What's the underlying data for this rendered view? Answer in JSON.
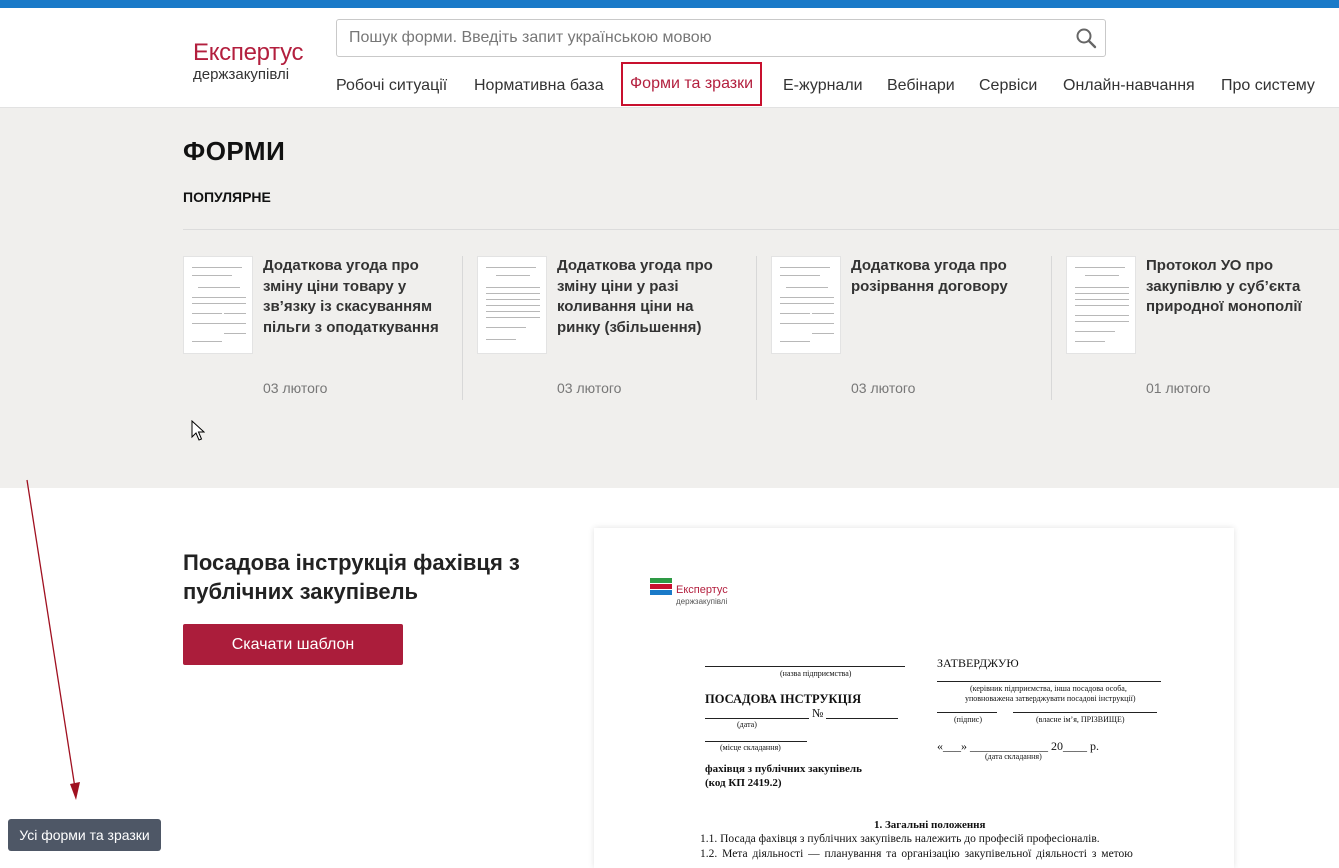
{
  "header": {
    "logo_main": "Експертус",
    "logo_sub": "держзакупівлі",
    "search_placeholder": "Пошук форми. Введіть запит українською мовою"
  },
  "nav": {
    "items": [
      {
        "label": "Робочі ситуації"
      },
      {
        "label": "Нормативна база"
      },
      {
        "label": "Форми та зразки",
        "active": true
      },
      {
        "label": "Е-журнали"
      },
      {
        "label": "Вебінари"
      },
      {
        "label": "Сервіси"
      },
      {
        "label": "Онлайн-навчання"
      },
      {
        "label": "Про систему"
      }
    ]
  },
  "forms": {
    "heading": "ФОРМИ",
    "popular_heading": "ПОПУЛЯРНЕ",
    "cards": [
      {
        "title": "Додаткова угода про зміну ціни товару у зв’язку із скасуванням пільги з оподаткування",
        "date": "03 лютого"
      },
      {
        "title": "Додаткова угода про зміну ціни у разі коливання ціни на ринку (збільшення)",
        "date": "03 лютого"
      },
      {
        "title": "Додаткова угода про розірвання договору",
        "date": "03 лютого"
      },
      {
        "title": "Протокол УО про закупівлю у суб’єкта природної монополії",
        "date": "01 лютого"
      }
    ]
  },
  "document": {
    "title": "Посадова інструкція фахівця з публічних закупівель",
    "download_label": "Скачати шаблон",
    "preview": {
      "logo_main": "Експертус",
      "logo_sub": "держзакупівлі",
      "company_caption": "(назва підприємства)",
      "approve": "ЗАТВЕРДЖУЮ",
      "head_caption_1": "(керівник підприємства, інша посадова особа,",
      "head_caption_2": "уповноважена затверджувати посадові інструкції)",
      "doc_name": "ПОСАДОВА ІНСТРУКЦІЯ",
      "number_sign": "№",
      "date_caption": "(дата)",
      "signature_caption": "(підпис)",
      "name_caption": "(власне ім’я, ПРІЗВИЩЕ)",
      "place_caption": "(місце складання)",
      "date_line": "«___» _____________ 20____ р.",
      "date_compiled_caption": "(дата складання)",
      "position_1": "фахівця з публічних закупівель",
      "position_2": "(код КП 2419.2)",
      "section_1": "1. Загальні положення",
      "para_1_1": "1.1. Посада фахівця з публічних закупівель належить до професій професіоналів.",
      "para_1_2": "1.2.  Мета діяльності — планування та організацію закупівельної діяльності з метою"
    }
  },
  "all_forms_button": "Усі форми та зразки",
  "colors": {
    "brand": "#b31f3e",
    "top_bar": "#1a7ac8",
    "button": "#ab1d3b",
    "bottom_button": "#4e5766"
  }
}
